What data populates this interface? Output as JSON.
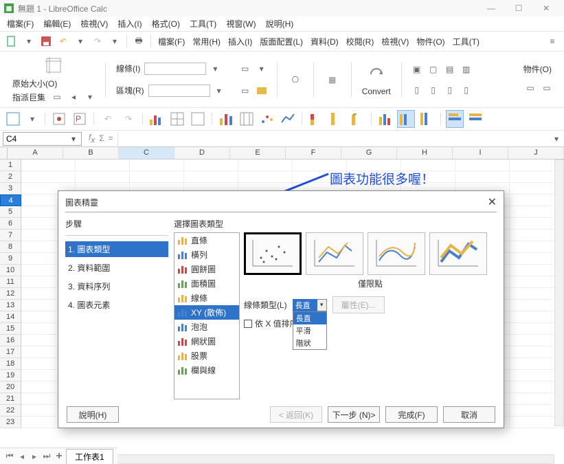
{
  "window": {
    "title": "無題 1 - LibreOffice Calc",
    "app_icon_text": "▦"
  },
  "menubar": {
    "items": [
      "檔案(F)",
      "編輯(E)",
      "檢視(V)",
      "插入(I)",
      "格式(O)",
      "工具(T)",
      "視窗(W)",
      "說明(H)"
    ]
  },
  "toolbar_tabs": [
    "檔案(F)",
    "常用(H)",
    "插入(I)",
    "版面配置(L)",
    "資料(D)",
    "校閱(R)",
    "檢視(V)",
    "物件(O)",
    "工具(T)"
  ],
  "toolbar2": {
    "original_size": "原始大小(O)",
    "assign_macro": "指派巨集",
    "line": "線條(I)",
    "region": "區塊(R)",
    "convert": "Convert",
    "objects": "物件(O)"
  },
  "namebox": {
    "value": "C4"
  },
  "columns": [
    "A",
    "B",
    "C",
    "D",
    "E",
    "F",
    "G",
    "H",
    "I",
    "J"
  ],
  "row_count": 23,
  "selected_row": 4,
  "selected_col_index": 2,
  "sheet_tab": "工作表1",
  "annotation_text": "圖表功能很多喔！",
  "dialog": {
    "title": "圖表精靈",
    "steps_heading": "步驟",
    "steps": [
      "1. 圖表類型",
      "2. 資料範圍",
      "3. 資料序列",
      "4. 圖表元素"
    ],
    "active_step_index": 0,
    "section_title": "選擇圖表類型",
    "chart_types": [
      "直條",
      "橫列",
      "圓餅圖",
      "面積圖",
      "線條",
      "XY (散佈)",
      "泡泡",
      "網狀圖",
      "股票",
      "欄與線"
    ],
    "selected_chart_type_index": 5,
    "preview_label": "僅限點",
    "line_type_label": "線條類型(L)",
    "line_type_value": "長直",
    "line_type_options": [
      "長直",
      "平滑",
      "階狀"
    ],
    "properties_btn": "屬性(E)...",
    "sort_checkbox": "依 X 值排序",
    "buttons": {
      "help": "說明(H)",
      "back": "< 返回(K)",
      "next": "下一步 (N)>",
      "finish": "完成(F)",
      "cancel": "取消"
    }
  }
}
